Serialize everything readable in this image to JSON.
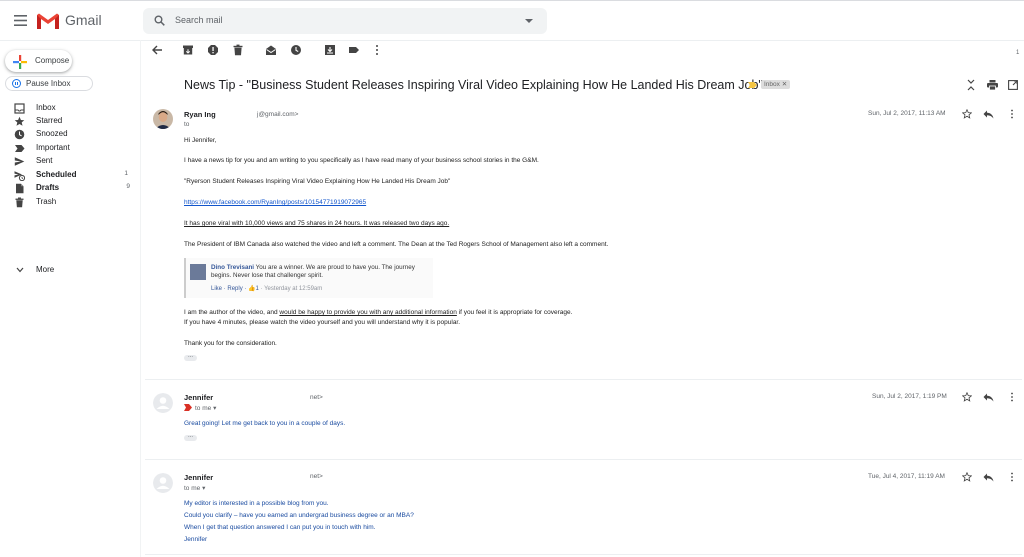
{
  "header": {
    "brand": "Gmail",
    "search_placeholder": "Search mail"
  },
  "sidebar": {
    "compose_label": "Compose",
    "pause_label": "Pause Inbox",
    "items": [
      {
        "label": "Inbox",
        "count": ""
      },
      {
        "label": "Starred",
        "count": ""
      },
      {
        "label": "Snoozed",
        "count": ""
      },
      {
        "label": "Important",
        "count": ""
      },
      {
        "label": "Sent",
        "count": ""
      },
      {
        "label": "Scheduled",
        "count": "1"
      },
      {
        "label": "Drafts",
        "count": "9"
      },
      {
        "label": "Trash",
        "count": ""
      }
    ],
    "more_label": "More"
  },
  "toolbar": {
    "page_indicator": "1"
  },
  "thread": {
    "subject": "News Tip - \"Business Student Releases Inspiring Viral Video Explaining How He Landed His Dream Job\"",
    "label": "Inbox",
    "messages": [
      {
        "sender": "Ryan Ing",
        "email": "j@gmail.com>",
        "to": "to",
        "date": "Sun, Jul 2, 2017, 11:13 AM",
        "greeting": "Hi Jennifer,",
        "p1": "I have a news tip for you and am writing to you specifically as I have read many of your business school stories in the G&M.",
        "p2": "\"Ryerson Student Releases Inspiring Viral Video Explaining How He Landed His Dream Job\"",
        "p3_link": "https://www.facebook.com/RyanIng/posts/10154771919072965",
        "p4": "It has gone viral with 10,000 views and 75 shares in 24 hours. It was released two days ago.",
        "p5": "The President of IBM Canada also watched the video and left a comment. The Dean at the Ted Rogers School of Management also left a comment.",
        "fb_name": "Dino Trevisani",
        "fb_comment": " You are a winner. We are proud to have you. The journey begins. Never lose that challenger spirit.",
        "fb_like": "Like",
        "fb_reply": "Reply",
        "fb_count": "1",
        "fb_time": "Yesterday at 12:59am",
        "p6_a": "I am the author of the video, and ",
        "p6_b": "would be happy to provide you with any additional information",
        "p6_c": " if you feel it is appropriate for coverage.",
        "p7": "If you have 4 minutes, please watch the video yourself and you will understand why it is popular.",
        "p8": "Thank you for the consideration."
      },
      {
        "sender": "Jennifer",
        "email": "net>",
        "to": "to me",
        "date": "Sun, Jul 2, 2017, 1:19 PM",
        "body": "Great going! Let me get back to you in a couple of days."
      },
      {
        "sender": "Jennifer",
        "email": "net>",
        "to": "to me",
        "date": "Tue, Jul 4, 2017, 11:19 AM",
        "lines": [
          "My editor is interested in a possible blog from you.",
          "Could you clarify – have you earned an undergrad business degree or an MBA?",
          "When I get that question answered I can put you in touch with him.",
          "Jennifer"
        ]
      }
    ]
  },
  "colors": {
    "gmail_red": "#ea4335",
    "link_blue": "#1155cc",
    "reply_blue": "#1a4ba0"
  }
}
